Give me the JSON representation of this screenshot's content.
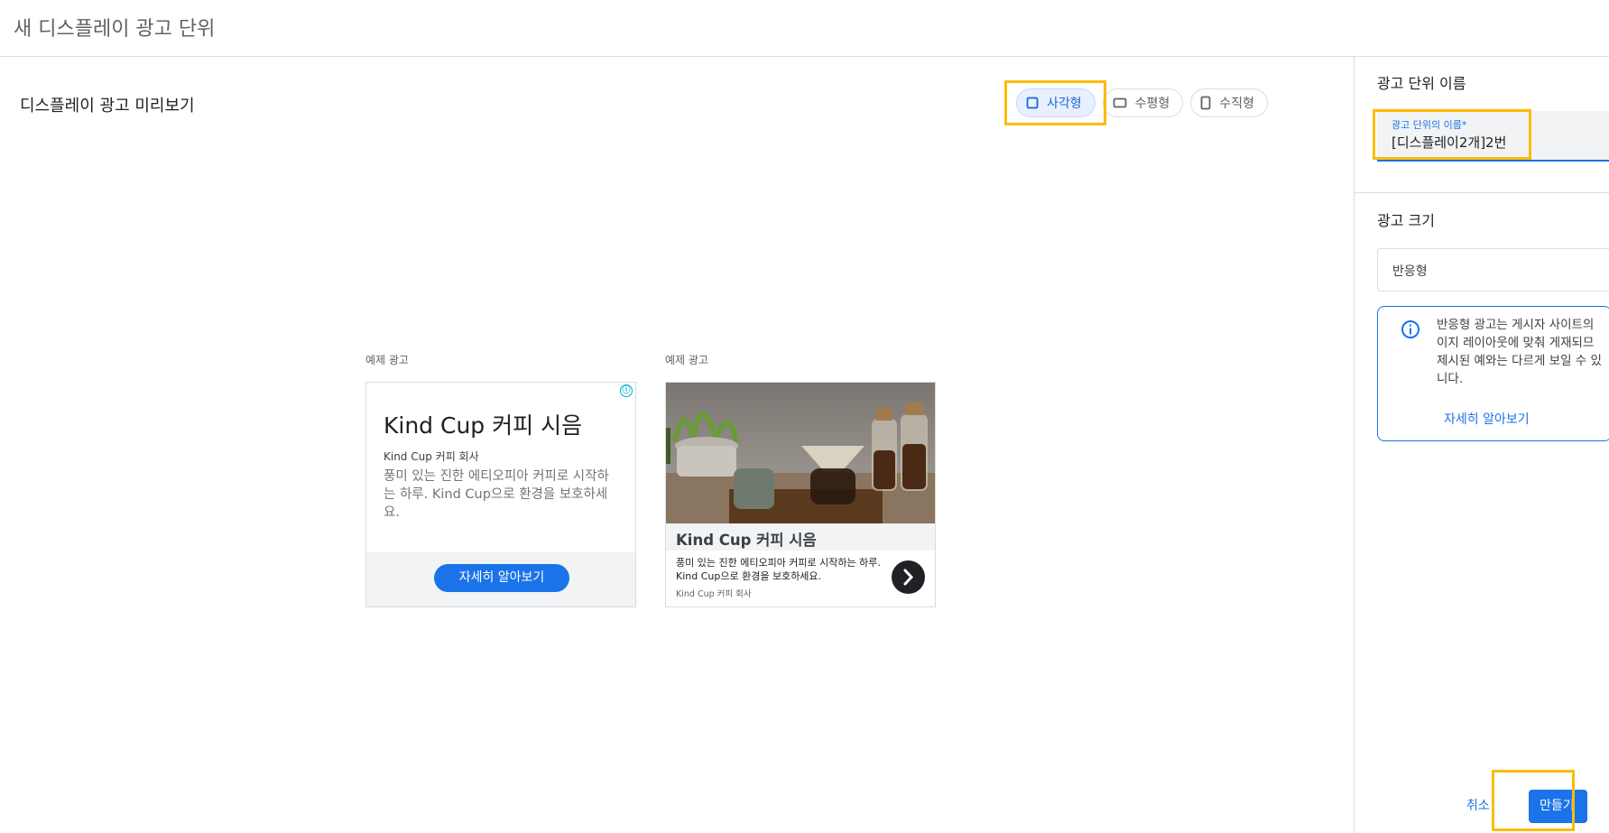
{
  "header": {
    "title": "새 디스플레이 광고 단위"
  },
  "preview": {
    "title": "디스플레이 광고 미리보기",
    "shape_options": [
      {
        "label": "사각형",
        "icon": "square-icon",
        "selected": true
      },
      {
        "label": "수평형",
        "icon": "horizontal-rect-icon",
        "selected": false
      },
      {
        "label": "수직형",
        "icon": "vertical-rect-icon",
        "selected": false
      }
    ],
    "ads": [
      {
        "label": "예제 광고",
        "headline": "Kind Cup 커피 시음",
        "company": "Kind Cup 커피 회사",
        "description": "풍미 있는 진한 에티오피아 커피로 시작하는 하루. Kind Cup으로 환경을 보호하세요.",
        "cta": "자세히 알아보기",
        "info_icon": "ⓘ"
      },
      {
        "label": "예제 광고",
        "headline": "Kind Cup 커피 시음",
        "description": "풍미 있는 진한 에티오피아 커피로 시작하는 하루. Kind Cup으로 환경을 보호하세요.",
        "company": "Kind Cup 커피 회사",
        "image": "coffee-pour-over-photo",
        "arrow_icon": "chevron-right-icon"
      }
    ]
  },
  "sidebar": {
    "name_section": {
      "title": "광고 단위 이름",
      "field_label": "광고 단위의 이름*",
      "field_value": "[디스플레이2개]2번"
    },
    "size_section": {
      "title": "광고 크기",
      "selected": "반응형",
      "info_text_lines": [
        "반응형 광고는 게시자 사이트의",
        "이지 레이아웃에 맞춰 게재되므",
        "제시된 예와는 다르게 보일 수 있",
        "니다."
      ],
      "learn_more": "자세히 알아보기"
    },
    "actions": {
      "cancel": "취소",
      "create": "만들기"
    }
  },
  "colors": {
    "accent": "#1a73e8",
    "highlight": "#fbbc04",
    "chip_selected_bg": "#e8f0fe"
  }
}
